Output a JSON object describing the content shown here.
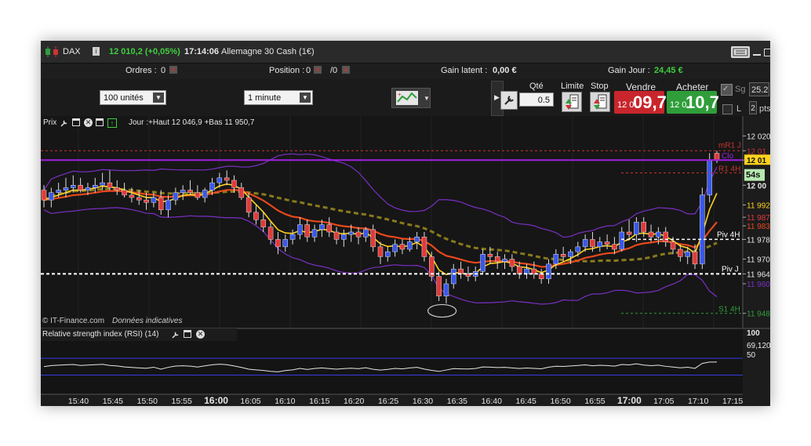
{
  "topbar": {
    "instrument": "DAX",
    "price_change": "12 010,2 (+0,05%)",
    "time": "17:14:06",
    "description": "Allemagne 30 Cash (1€)"
  },
  "orderbar": {
    "ordres_label": "Ordres :",
    "ordres_value": "0",
    "position_label": "Position :",
    "position_value": "0",
    "position_fraction": "/0",
    "gain_latent_label": "Gain latent :",
    "gain_latent_value": "0,00 €",
    "gain_jour_label": "Gain Jour :",
    "gain_jour_value": "24,45 €"
  },
  "controls": {
    "units": "100 unités",
    "interval": "1 minute",
    "qty_label": "Qté",
    "qty_value": "0.5",
    "limit_label": "Limite",
    "stop_label": "Stop",
    "sell_label": "Vendre",
    "buy_label": "Acheter",
    "sell_small": "12 0",
    "sell_big": "09,7",
    "buy_small": "12 0",
    "buy_big": "10,7",
    "sg_label": "Sg",
    "sg_value": "25.2",
    "l_label": "L",
    "pts_value": "2",
    "pts_label": "pts"
  },
  "chart_header": {
    "prix_label": "Prix",
    "info": "Jour :+Haut 12 046,9 +Bas 11 950,7"
  },
  "watermark": {
    "source": "© IT-Finance.com",
    "note": "Données indicatives"
  },
  "levels": {
    "mr1": "mR1 J",
    "r1_4h": "R1 4H",
    "piv_4h": "Piv 4H",
    "piv_j": "Piv J",
    "s1_4h": "S1 4H",
    "clo": "Clo",
    "countdown": "54s"
  },
  "price_axis": [
    {
      "label": "12 020",
      "price": 12020
    },
    {
      "label": "12 01",
      "price": 12014
    },
    {
      "label": "12 01",
      "price": 12010.2
    },
    {
      "label": "12 00",
      "price": 12000
    },
    {
      "label": "11 992",
      "price": 11992
    },
    {
      "label": "11 987",
      "price": 11987
    },
    {
      "label": "11 983",
      "price": 11983.5
    },
    {
      "label": "11 978",
      "price": 11978
    },
    {
      "label": "11 970",
      "price": 11970
    },
    {
      "label": "11 964",
      "price": 11964
    },
    {
      "label": "11 960",
      "price": 11960
    },
    {
      "label": "11 948",
      "price": 11948
    }
  ],
  "rsi": {
    "title": "Relative strength index (RSI) (14)",
    "top": "100",
    "value": "69,120",
    "mid": "50"
  },
  "time_axis": [
    "15:40",
    "15:45",
    "15:50",
    "15:55",
    "16:00",
    "16:05",
    "16:10",
    "16:15",
    "16:20",
    "16:25",
    "16:30",
    "16:35",
    "16:40",
    "16:45",
    "16:50",
    "16:55",
    "17:00",
    "17:05",
    "17:10",
    "17:15"
  ],
  "colors": {
    "up": "#3a58e8",
    "down": "#e23a3a",
    "ma_fast": "#ffd21c",
    "ma_slow": "#e8491c",
    "ma_long": "#8a7a1c",
    "bollinger": "#7a2fc4",
    "close_line": "#a020e0",
    "positive": "#3ecf3e"
  },
  "chart_data": {
    "type": "candlestick",
    "y_range": [
      11946,
      12023
    ],
    "candles": [
      [
        11998,
        12000,
        11991,
        11994
      ],
      [
        11994,
        11999,
        11991,
        11997
      ],
      [
        11997,
        12001,
        11995,
        11998
      ],
      [
        11998,
        12003,
        11995,
        11999
      ],
      [
        11999,
        12004,
        11997,
        12000
      ],
      [
        12000,
        12003,
        11997,
        11998
      ],
      [
        11998,
        12001,
        11996,
        11999
      ],
      [
        11999,
        12003,
        11997,
        12000
      ],
      [
        12000,
        12005,
        11998,
        12001
      ],
      [
        12001,
        12006,
        11998,
        11999
      ],
      [
        11999,
        12002,
        11996,
        11998
      ],
      [
        11998,
        12001,
        11995,
        11996
      ],
      [
        11996,
        11999,
        11993,
        11995
      ],
      [
        11995,
        11998,
        11992,
        11994
      ],
      [
        11994,
        11997,
        11990,
        11993
      ],
      [
        11993,
        11997,
        11991,
        11995
      ],
      [
        11995,
        11998,
        11988,
        11990
      ],
      [
        11990,
        11996,
        11987,
        11994
      ],
      [
        11994,
        11999,
        11992,
        11997
      ],
      [
        11997,
        12000,
        11994,
        11998
      ],
      [
        11998,
        12002,
        11996,
        11997
      ],
      [
        11997,
        12000,
        11994,
        11995
      ],
      [
        11995,
        11999,
        11993,
        11998
      ],
      [
        11998,
        12003,
        11996,
        12001
      ],
      [
        12001,
        12005,
        11999,
        12003
      ],
      [
        12003,
        12006,
        12000,
        12002
      ],
      [
        12002,
        12004,
        11997,
        11999
      ],
      [
        11999,
        12001,
        11994,
        11995
      ],
      [
        11995,
        11997,
        11987,
        11989
      ],
      [
        11989,
        11992,
        11984,
        11986
      ],
      [
        11986,
        11989,
        11981,
        11983
      ],
      [
        11983,
        11985,
        11976,
        11978
      ],
      [
        11978,
        11981,
        11972,
        11975
      ],
      [
        11975,
        11980,
        11973,
        11978
      ],
      [
        11978,
        11982,
        11976,
        11980
      ],
      [
        11980,
        11987,
        11978,
        11984
      ],
      [
        11984,
        11986,
        11977,
        11979
      ],
      [
        11979,
        11984,
        11977,
        11982
      ],
      [
        11982,
        11986,
        11979,
        11984
      ],
      [
        11984,
        11987,
        11979,
        11981
      ],
      [
        11981,
        11983,
        11976,
        11978
      ],
      [
        11978,
        11982,
        11975,
        11980
      ],
      [
        11980,
        11984,
        11977,
        11981
      ],
      [
        11981,
        11983,
        11976,
        11979
      ],
      [
        11979,
        11983,
        11977,
        11982
      ],
      [
        11982,
        11984,
        11973,
        11975
      ],
      [
        11975,
        11977,
        11968,
        11971
      ],
      [
        11971,
        11975,
        11969,
        11973
      ],
      [
        11973,
        11978,
        11971,
        11976
      ],
      [
        11976,
        11978,
        11972,
        11974
      ],
      [
        11974,
        11979,
        11973,
        11977
      ],
      [
        11977,
        11981,
        11974,
        11979
      ],
      [
        11979,
        11981,
        11969,
        11971
      ],
      [
        11971,
        11973,
        11961,
        11963
      ],
      [
        11963,
        11965,
        11953,
        11955
      ],
      [
        11955,
        11962,
        11952,
        11960
      ],
      [
        11960,
        11968,
        11958,
        11966
      ],
      [
        11966,
        11969,
        11962,
        11964
      ],
      [
        11964,
        11967,
        11961,
        11963
      ],
      [
        11963,
        11967,
        11961,
        11965
      ],
      [
        11965,
        11974,
        11964,
        11972
      ],
      [
        11972,
        11975,
        11968,
        11971
      ],
      [
        11971,
        11973,
        11966,
        11969
      ],
      [
        11969,
        11972,
        11966,
        11970
      ],
      [
        11970,
        11972,
        11965,
        11967
      ],
      [
        11967,
        11969,
        11962,
        11964
      ],
      [
        11964,
        11968,
        11962,
        11966
      ],
      [
        11966,
        11969,
        11962,
        11964
      ],
      [
        11964,
        11966,
        11960,
        11962
      ],
      [
        11962,
        11970,
        11960,
        11968
      ],
      [
        11968,
        11974,
        11966,
        11972
      ],
      [
        11972,
        11975,
        11969,
        11971
      ],
      [
        11971,
        11974,
        11968,
        11973
      ],
      [
        11973,
        11977,
        11971,
        11975
      ],
      [
        11975,
        11980,
        11973,
        11978
      ],
      [
        11978,
        11981,
        11973,
        11975
      ],
      [
        11975,
        11979,
        11973,
        11977
      ],
      [
        11977,
        11980,
        11974,
        11976
      ],
      [
        11976,
        11979,
        11972,
        11974
      ],
      [
        11974,
        11983,
        11973,
        11981
      ],
      [
        11981,
        11986,
        11978,
        11980
      ],
      [
        11980,
        11987,
        11977,
        11985
      ],
      [
        11985,
        11987,
        11979,
        11981
      ],
      [
        11981,
        11984,
        11977,
        11979
      ],
      [
        11979,
        11983,
        11976,
        11981
      ],
      [
        11981,
        11983,
        11975,
        11977
      ],
      [
        11977,
        11979,
        11972,
        11974
      ],
      [
        11974,
        11976,
        11969,
        11971
      ],
      [
        11971,
        11975,
        11968,
        11973
      ],
      [
        11973,
        11976,
        11966,
        11968
      ],
      [
        11968,
        11999,
        11966,
        11996
      ],
      [
        11996,
        12013,
        11993,
        12010
      ],
      [
        12013,
        12014,
        12009,
        12010
      ]
    ]
  }
}
